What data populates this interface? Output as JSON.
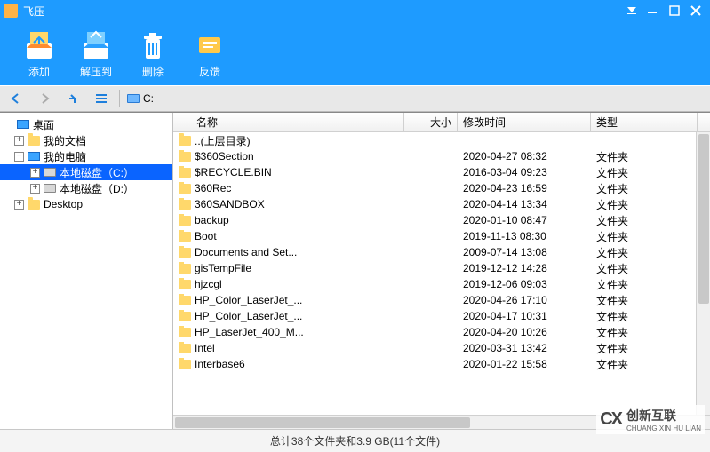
{
  "app": {
    "title": "飞压"
  },
  "toolbar": {
    "add": "添加",
    "extract": "解压到",
    "delete": "删除",
    "feedback": "反馈"
  },
  "nav": {
    "drive_label": "C:"
  },
  "tree": {
    "desktop": "桌面",
    "my_docs": "我的文档",
    "my_pc": "我的电脑",
    "drive_c": "本地磁盘（C:）",
    "drive_d": "本地磁盘（D:）",
    "desktop2": "Desktop"
  },
  "columns": {
    "name": "名称",
    "size": "大小",
    "time": "修改时间",
    "type": "类型"
  },
  "rows": [
    {
      "name": "..(上层目录)",
      "size": "",
      "time": "",
      "type": ""
    },
    {
      "name": "$360Section",
      "size": "",
      "time": "2020-04-27 08:32",
      "type": "文件夹"
    },
    {
      "name": "$RECYCLE.BIN",
      "size": "",
      "time": "2016-03-04 09:23",
      "type": "文件夹"
    },
    {
      "name": "360Rec",
      "size": "",
      "time": "2020-04-23 16:59",
      "type": "文件夹"
    },
    {
      "name": "360SANDBOX",
      "size": "",
      "time": "2020-04-14 13:34",
      "type": "文件夹"
    },
    {
      "name": "backup",
      "size": "",
      "time": "2020-01-10 08:47",
      "type": "文件夹"
    },
    {
      "name": "Boot",
      "size": "",
      "time": "2019-11-13 08:30",
      "type": "文件夹"
    },
    {
      "name": "Documents and Set...",
      "size": "",
      "time": "2009-07-14 13:08",
      "type": "文件夹"
    },
    {
      "name": "gisTempFile",
      "size": "",
      "time": "2019-12-12 14:28",
      "type": "文件夹"
    },
    {
      "name": "hjzcgl",
      "size": "",
      "time": "2019-12-06 09:03",
      "type": "文件夹"
    },
    {
      "name": "HP_Color_LaserJet_...",
      "size": "",
      "time": "2020-04-26 17:10",
      "type": "文件夹"
    },
    {
      "name": "HP_Color_LaserJet_...",
      "size": "",
      "time": "2020-04-17 10:31",
      "type": "文件夹"
    },
    {
      "name": "HP_LaserJet_400_M...",
      "size": "",
      "time": "2020-04-20 10:26",
      "type": "文件夹"
    },
    {
      "name": "Intel",
      "size": "",
      "time": "2020-03-31 13:42",
      "type": "文件夹"
    },
    {
      "name": "Interbase6",
      "size": "",
      "time": "2020-01-22 15:58",
      "type": "文件夹"
    }
  ],
  "status": "总计38个文件夹和3.9 GB(11个文件)",
  "watermark": {
    "brand": "创新互联",
    "tagline": "CHUANG XIN HU LIAN"
  }
}
